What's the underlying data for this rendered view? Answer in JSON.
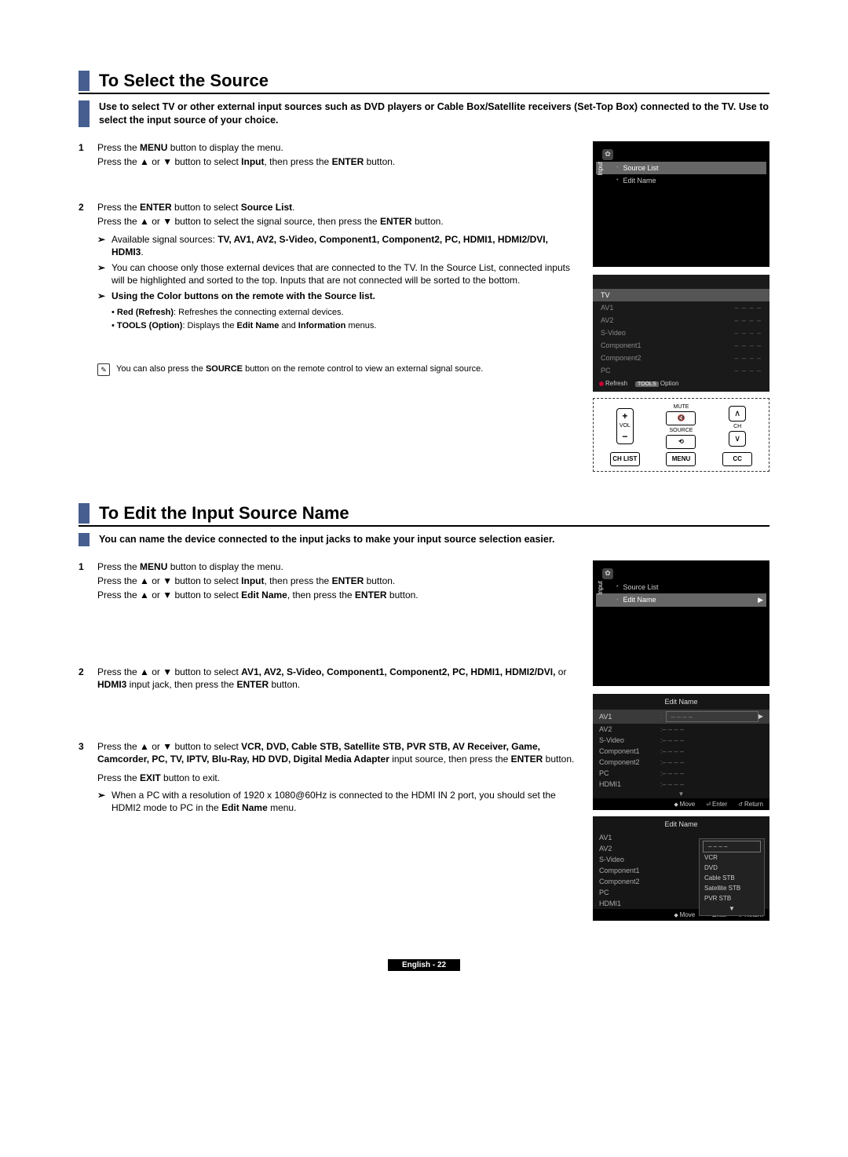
{
  "section1": {
    "heading": "To Select the Source",
    "intro": "Use to select TV or other external input sources such as DVD players or Cable Box/Satellite receivers (Set-Top Box) connected to the TV. Use to select the input source of your choice.",
    "step1": {
      "num": "1",
      "l1a": "Press the ",
      "l1b": "MENU",
      "l1c": " button to display the menu.",
      "l2a": "Press the ▲ or ▼ button to select ",
      "l2b": "Input",
      "l2c": ", then press the ",
      "l2d": "ENTER",
      "l2e": " button."
    },
    "step2": {
      "num": "2",
      "l1a": "Press the ",
      "l1b": "ENTER",
      "l1c": " button to select ",
      "l1d": "Source List",
      "l1e": ".",
      "l2a": "Press the ▲ or ▼ button to select the signal source, then press the ",
      "l2b": "ENTER",
      "l2c": " button.",
      "sub1a": "Available signal sources: ",
      "sub1b": "TV, AV1, AV2, S-Video, Component1, Component2, PC, HDMI1, HDMI2/DVI, HDMI3",
      "sub1c": ".",
      "sub2": "You can choose only those external devices that are connected to the TV. In the Source List, connected inputs will be highlighted and sorted to the top. Inputs that are not connected will be sorted to the bottom.",
      "sub3": "Using the Color buttons on the remote with the Source list.",
      "b1a": "Red (Refresh)",
      "b1b": ": Refreshes the connecting external devices.",
      "b2a": "TOOLS (Option)",
      "b2b": ": Displays the ",
      "b2c": "Edit Name",
      "b2d": " and ",
      "b2e": "Information",
      "b2f": " menus."
    },
    "note": {
      "a": "You can also press the ",
      "b": "SOURCE",
      "c": " button on the remote control to view an external signal source."
    },
    "menu": {
      "input": "Input",
      "source_list": "Source List",
      "edit_name": "Edit Name"
    },
    "src": {
      "tv": "TV",
      "av1": "AV1",
      "av2": "AV2",
      "svideo": "S-Video",
      "c1": "Component1",
      "c2": "Component2",
      "pc": "PC",
      "dashes": "– – – –",
      "refresh": "Refresh",
      "option": "Option"
    },
    "remote": {
      "mute": "MUTE",
      "vol": "VOL",
      "source": "SOURCE",
      "ch": "CH",
      "chlist": "CH LIST",
      "menu": "MENU",
      "cc": "CC",
      "plus": "+",
      "minus": "−"
    }
  },
  "section2": {
    "heading": "To Edit the Input Source Name",
    "intro": "You can name the device connected to the input jacks to make your input source selection easier.",
    "step1": {
      "num": "1",
      "l1a": "Press the ",
      "l1b": "MENU",
      "l1c": " button to display the menu.",
      "l2a": "Press the ▲ or ▼ button to select ",
      "l2b": "Input",
      "l2c": ", then press the ",
      "l2d": "ENTER",
      "l2e": " button.",
      "l3a": "Press the ▲ or ▼ button to select ",
      "l3b": "Edit Name",
      "l3c": ", then press the ",
      "l3d": "ENTER",
      "l3e": " button."
    },
    "step2": {
      "num": "2",
      "l1a": "Press the ▲ or ▼ button to select ",
      "l1b": "AV1, AV2, S-Video, Component1, Component2, PC, HDMI1, HDMI2/DVI,",
      "l1c": " or ",
      "l1d": "HDMI3",
      "l1e": " input jack, then press the ",
      "l1f": "ENTER",
      "l1g": " button."
    },
    "step3": {
      "num": "3",
      "l1a": "Press the ▲ or ▼ button to select ",
      "l1b": "VCR, DVD, Cable STB, Satellite STB, PVR STB, AV Receiver, Game, Camcorder, PC, TV, IPTV, Blu-Ray, HD DVD, Digital Media Adapter",
      "l1c": " input source, then press the ",
      "l1d": "ENTER",
      "l1e": " button.",
      "l2a": "Press the ",
      "l2b": "EXIT",
      "l2c": " button to exit.",
      "sub1a": "When a PC with a resolution of 1920 x 1080@60Hz is connected to the HDMI IN 2 port, you should set the HDMI2 mode to PC in the ",
      "sub1b": "Edit Name",
      "sub1c": " menu."
    },
    "menu": {
      "source_list": "Source List",
      "edit_name": "Edit Name",
      "input": "Input"
    },
    "ed": {
      "title": "Edit Name",
      "av1": "AV1",
      "av2": "AV2",
      "sv": "S-Video",
      "c1": "Component1",
      "c2": "Component2",
      "pc": "PC",
      "h1": "HDMI1",
      "dash": "– – – –",
      "arrow_down": "▼"
    },
    "popup": {
      "vcr": "VCR",
      "dvd": "DVD",
      "cstb": "Cable STB",
      "sstb": "Satellite STB",
      "pstb": "PVR STB",
      "arrow": "▼"
    },
    "nav": {
      "move": "Move",
      "enter": "Enter",
      "ret": "Return"
    }
  },
  "footer": "English - 22",
  "glyph": {
    "tri": "▶",
    "note": "✎",
    "mark": "➢",
    "bullet": "•",
    "color": ": "
  }
}
